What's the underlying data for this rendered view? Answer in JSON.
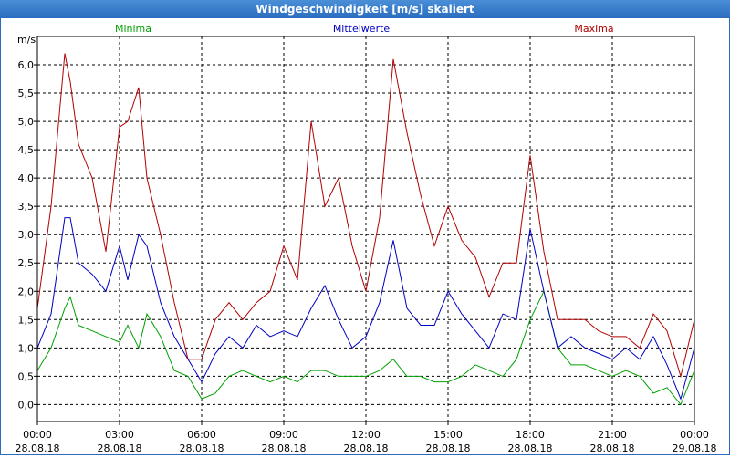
{
  "window": {
    "title": "Windgeschwindigkeit [m/s] skaliert"
  },
  "chart_data": {
    "type": "line",
    "title": "Windgeschwindigkeit [m/s] skaliert",
    "ylabel": "m/s",
    "ylim": [
      -0.3,
      6.5
    ],
    "xlim": [
      0,
      24
    ],
    "grid": true,
    "y_ticks": [
      "0,0",
      "0,5",
      "1,0",
      "1,5",
      "2,0",
      "2,5",
      "3,0",
      "3,5",
      "4,0",
      "4,5",
      "5,0",
      "5,5",
      "6,0"
    ],
    "y_tick_values": [
      0,
      0.5,
      1,
      1.5,
      2,
      2.5,
      3,
      3.5,
      4,
      4.5,
      5,
      5.5,
      6
    ],
    "x_ticks": [
      {
        "time": "00:00",
        "date": "28.08.18"
      },
      {
        "time": "03:00",
        "date": "28.08.18"
      },
      {
        "time": "06:00",
        "date": "28.08.18"
      },
      {
        "time": "09:00",
        "date": "28.08.18"
      },
      {
        "time": "12:00",
        "date": "28.08.18"
      },
      {
        "time": "15:00",
        "date": "28.08.18"
      },
      {
        "time": "18:00",
        "date": "28.08.18"
      },
      {
        "time": "21:00",
        "date": "28.08.18"
      },
      {
        "time": "00:00",
        "date": "29.08.18"
      }
    ],
    "x_tick_hours": [
      0,
      3,
      6,
      9,
      12,
      15,
      18,
      21,
      24
    ],
    "series": [
      {
        "name": "Minima",
        "color": "#00a000",
        "x": [
          0,
          0.5,
          1,
          1.2,
          1.5,
          2,
          2.5,
          3,
          3.3,
          3.7,
          4,
          4.5,
          5,
          5.5,
          6,
          6.5,
          7,
          7.5,
          8,
          8.5,
          9,
          9.5,
          10,
          10.5,
          11,
          11.5,
          12,
          12.5,
          13,
          13.5,
          14,
          14.5,
          15,
          15.5,
          16,
          16.5,
          17,
          17.5,
          18,
          18.5,
          19,
          19.5,
          20,
          20.5,
          21,
          21.5,
          22,
          22.5,
          23,
          23.5,
          24
        ],
        "y": [
          0.6,
          1.0,
          1.7,
          1.9,
          1.4,
          1.3,
          1.2,
          1.1,
          1.4,
          1.0,
          1.6,
          1.2,
          0.6,
          0.5,
          0.1,
          0.2,
          0.5,
          0.6,
          0.5,
          0.4,
          0.5,
          0.4,
          0.6,
          0.6,
          0.5,
          0.5,
          0.5,
          0.6,
          0.8,
          0.5,
          0.5,
          0.4,
          0.4,
          0.5,
          0.7,
          0.6,
          0.5,
          0.8,
          1.5,
          2.0,
          1.0,
          0.7,
          0.7,
          0.6,
          0.5,
          0.6,
          0.5,
          0.2,
          0.3,
          0.0,
          0.6
        ]
      },
      {
        "name": "Mittelwerte",
        "color": "#0000c0",
        "x": [
          0,
          0.5,
          1,
          1.2,
          1.5,
          2,
          2.5,
          3,
          3.3,
          3.7,
          4,
          4.5,
          5,
          5.5,
          6,
          6.5,
          7,
          7.5,
          8,
          8.5,
          9,
          9.5,
          10,
          10.5,
          11,
          11.5,
          12,
          12.5,
          13,
          13.5,
          14,
          14.5,
          15,
          15.5,
          16,
          16.5,
          17,
          17.5,
          18,
          18.5,
          19,
          19.5,
          20,
          20.5,
          21,
          21.5,
          22,
          22.5,
          23,
          23.5,
          24
        ],
        "y": [
          1.0,
          1.6,
          3.3,
          3.3,
          2.5,
          2.3,
          2.0,
          2.8,
          2.2,
          3.0,
          2.8,
          1.8,
          1.2,
          0.8,
          0.4,
          0.9,
          1.2,
          1.0,
          1.4,
          1.2,
          1.3,
          1.2,
          1.7,
          2.1,
          1.5,
          1.0,
          1.2,
          1.8,
          2.9,
          1.7,
          1.4,
          1.4,
          2.0,
          1.6,
          1.3,
          1.0,
          1.6,
          1.5,
          3.1,
          2.0,
          1.0,
          1.2,
          1.0,
          0.9,
          0.8,
          1.0,
          0.8,
          1.2,
          0.7,
          0.1,
          1.0
        ]
      },
      {
        "name": "Maxima",
        "color": "#b00000",
        "x": [
          0,
          0.5,
          1,
          1.2,
          1.5,
          2,
          2.5,
          3,
          3.3,
          3.7,
          4,
          4.5,
          5,
          5.5,
          6,
          6.5,
          7,
          7.5,
          8,
          8.5,
          9,
          9.5,
          10,
          10.5,
          11,
          11.5,
          12,
          12.5,
          13,
          13.5,
          14,
          14.5,
          15,
          15.5,
          16,
          16.5,
          17,
          17.5,
          18,
          18.5,
          19,
          19.5,
          20,
          20.5,
          21,
          21.5,
          22,
          22.5,
          23,
          23.5,
          24
        ],
        "y": [
          1.7,
          3.5,
          6.2,
          5.7,
          4.6,
          4.0,
          2.7,
          4.9,
          5.0,
          5.6,
          4.0,
          3.0,
          1.8,
          0.8,
          0.8,
          1.5,
          1.8,
          1.5,
          1.8,
          2.0,
          2.8,
          2.2,
          5.0,
          3.5,
          4.0,
          2.8,
          2.0,
          3.3,
          6.1,
          4.8,
          3.7,
          2.8,
          3.5,
          2.9,
          2.6,
          1.9,
          2.5,
          2.5,
          4.4,
          2.7,
          1.5,
          1.5,
          1.5,
          1.3,
          1.2,
          1.2,
          1.0,
          1.6,
          1.3,
          0.5,
          1.5
        ]
      }
    ]
  }
}
